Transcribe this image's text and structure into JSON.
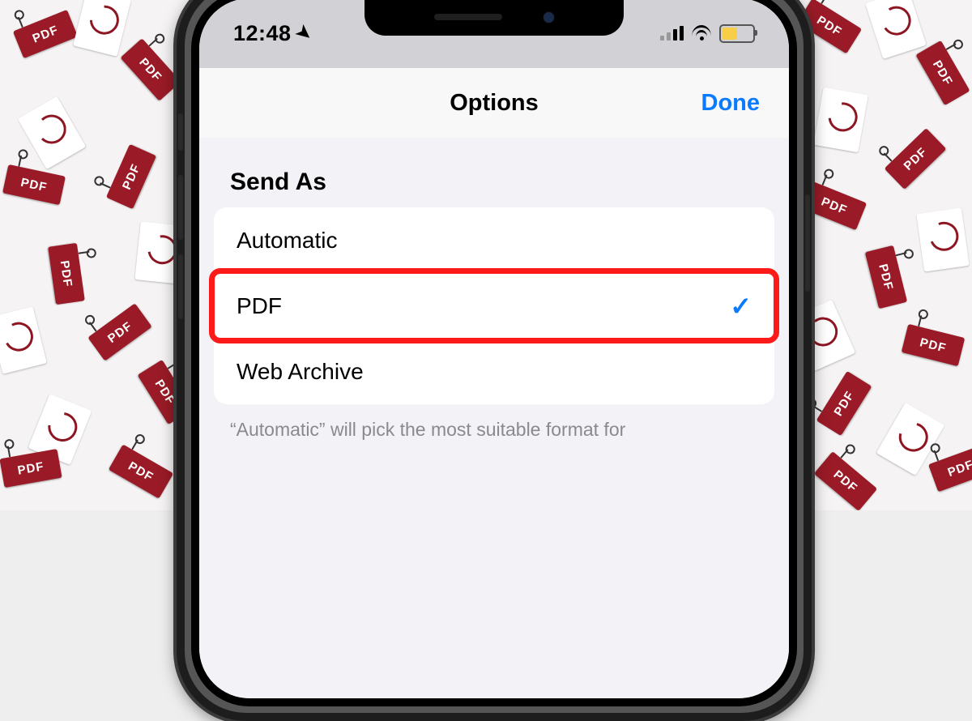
{
  "status": {
    "time": "12:48"
  },
  "nav": {
    "title": "Options",
    "done": "Done"
  },
  "section": {
    "header": "Send As"
  },
  "options": {
    "0": {
      "label": "Automatic"
    },
    "1": {
      "label": "PDF"
    },
    "2": {
      "label": "Web Archive"
    }
  },
  "footnote": "“Automatic” will pick the most suitable format for"
}
